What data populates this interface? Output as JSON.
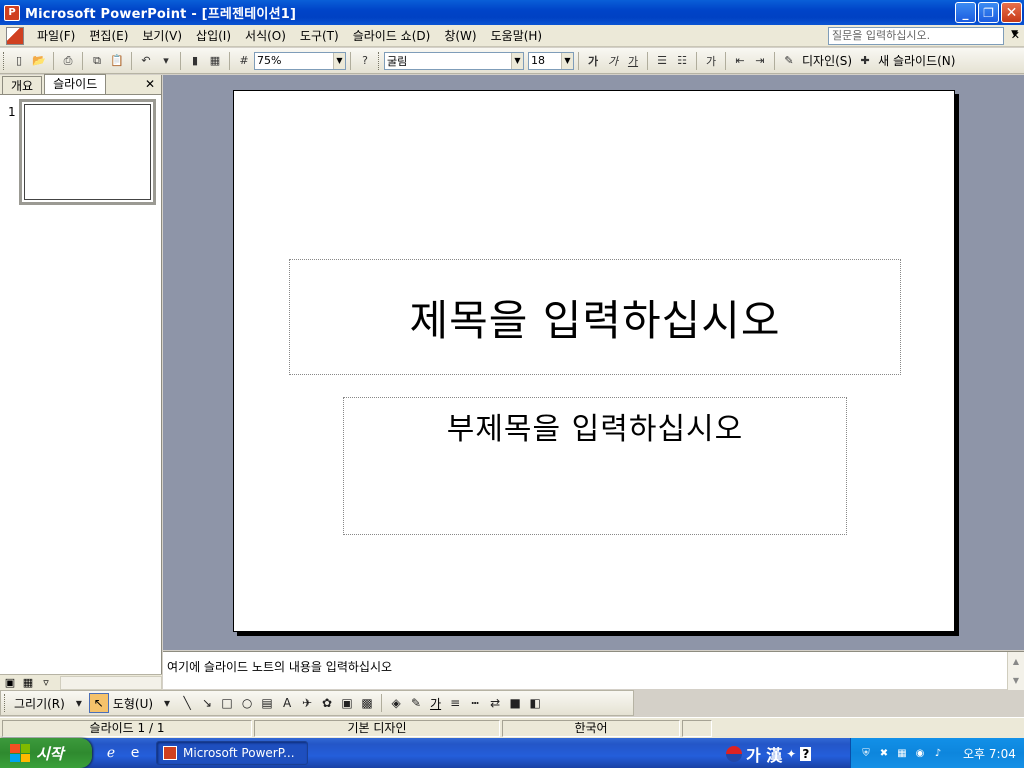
{
  "window": {
    "title": "Microsoft PowerPoint - [프레젠테이션1]"
  },
  "menu": {
    "items": [
      "파일(F)",
      "편집(E)",
      "보기(V)",
      "삽입(I)",
      "서식(O)",
      "도구(T)",
      "슬라이드 쇼(D)",
      "창(W)",
      "도움말(H)"
    ],
    "ask_placeholder": "질문을 입력하십시오."
  },
  "toolbar": {
    "zoom": "75%",
    "font": "굴림",
    "font_size": "18",
    "bold_label": "가",
    "italic_label": "가",
    "underline_label": "가",
    "indent_label": "가",
    "design_label": "디자인(S)",
    "new_slide_label": "새 슬라이드(N)"
  },
  "left_pane": {
    "tabs": [
      "개요",
      "슬라이드"
    ],
    "slide_number": "1"
  },
  "slide": {
    "title_placeholder": "제목을 입력하십시오",
    "subtitle_placeholder": "부제목을 입력하십시오"
  },
  "notes": {
    "placeholder": "여기에 슬라이드 노트의 내용을 입력하십시오"
  },
  "draw_toolbar": {
    "draw_label": "그리기(R)",
    "shapes_label": "도형(U)",
    "font_color_label": "가"
  },
  "status": {
    "slide": "슬라이드 1 / 1",
    "design": "기본 디자인",
    "language": "한국어"
  },
  "taskbar": {
    "start_label": "시작",
    "task_label": "Microsoft PowerP...",
    "ime_label": "가 漢",
    "clock": "오후 7:04"
  }
}
